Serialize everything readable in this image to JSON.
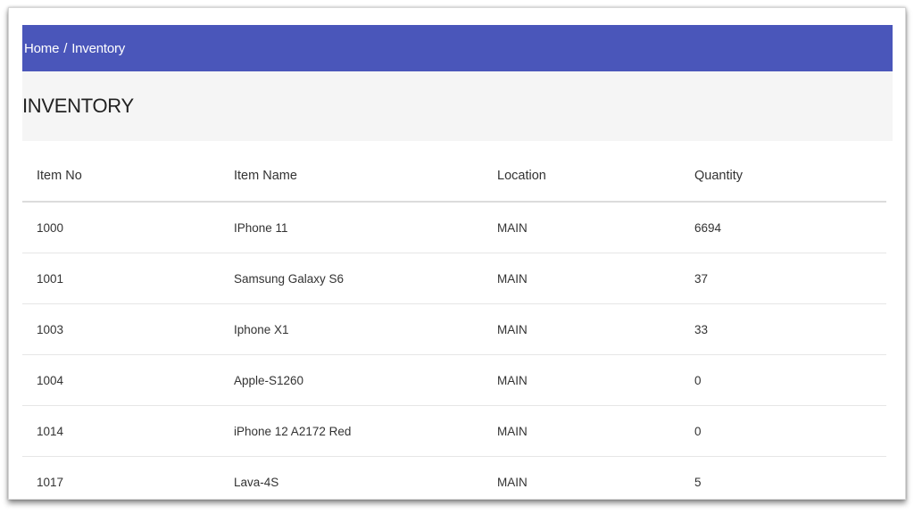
{
  "breadcrumb": {
    "home": "Home",
    "separator": "/",
    "current": "Inventory"
  },
  "page": {
    "title": "INVENTORY"
  },
  "table": {
    "headers": [
      "Item No",
      "Item Name",
      "Location",
      "Quantity"
    ],
    "rows": [
      [
        "1000",
        "IPhone 11",
        "MAIN",
        "6694"
      ],
      [
        "1001",
        "Samsung Galaxy S6",
        "MAIN",
        "37"
      ],
      [
        "1003",
        "Iphone X1",
        "MAIN",
        "33"
      ],
      [
        "1004",
        "Apple-S1260",
        "MAIN",
        "0"
      ],
      [
        "1014",
        "iPhone 12 A2172 Red",
        "MAIN",
        "0"
      ],
      [
        "1017",
        "Lava-4S",
        "MAIN",
        "5"
      ]
    ]
  },
  "colors": {
    "header_bar": "#4a56ba",
    "title_band": "#f5f5f5",
    "text": "#333333"
  }
}
